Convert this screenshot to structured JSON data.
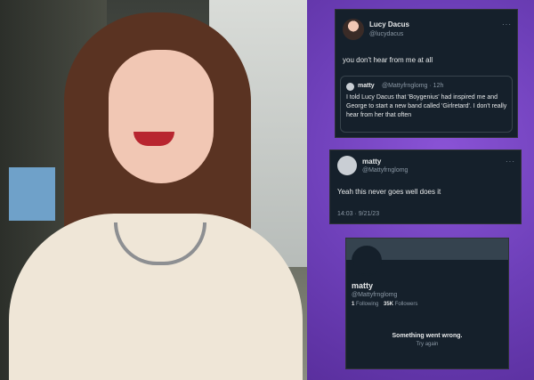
{
  "tweet1": {
    "name": "Lucy Dacus",
    "handle": "@lucydacus",
    "more": "···",
    "text": "you don't hear from me at all",
    "quote": {
      "name": "matty",
      "meta": "@Mattyfrnglomg · 12h",
      "text": "I told Lucy Dacus that 'Boygenius' had inspired me and George to start a new band called 'Girlretard'. I don't really hear from her that often"
    }
  },
  "tweet2": {
    "name": "matty",
    "handle": "@Mattyfrnglomg",
    "more": "···",
    "text": "Yeah this never goes well does it",
    "timestamp": "14:03 · 9/21/23"
  },
  "profile": {
    "name": "matty",
    "handle": "@Mattyfrnglomg",
    "following_count": "1",
    "following_label": "Following",
    "followers_count": "35K",
    "followers_label": "Followers",
    "error_text": "Something went wrong.",
    "retry_label": "Try again"
  },
  "colors": {
    "background_purple": "#6b3fb5",
    "card_bg": "#15202b",
    "text_primary": "#e7e9ea",
    "text_secondary": "#8b98a5"
  }
}
